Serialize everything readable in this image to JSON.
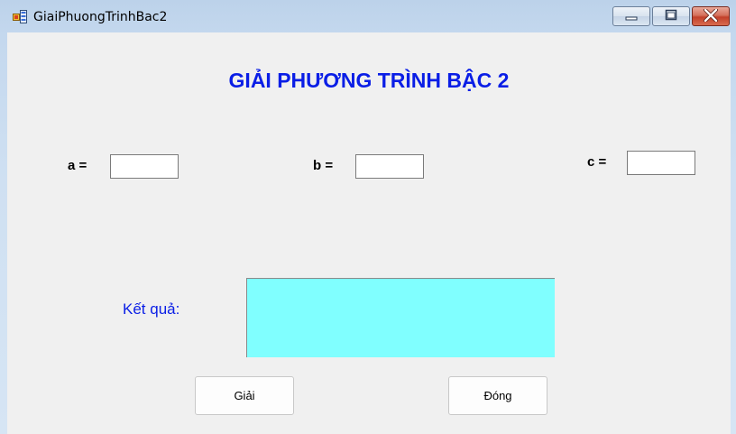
{
  "window": {
    "title": "GiaiPhuongTrinhBac2",
    "controls": {
      "minimize": "minimize-icon",
      "maximize": "maximize-icon",
      "close": "close-icon"
    }
  },
  "form": {
    "heading": "GIẢI PHƯƠNG TRÌNH BẬC 2",
    "labels": {
      "a": "a =",
      "b": "b =",
      "c": "c ="
    },
    "inputs": {
      "a": "",
      "b": "",
      "c": ""
    },
    "result_label": "Kết quả:",
    "result_value": "",
    "buttons": {
      "solve": "Giải",
      "close": "Đóng"
    }
  },
  "colors": {
    "heading": "#0a1ee6",
    "result_label": "#0a1ee6",
    "result_box": "#80ffff",
    "client_bg": "#f0f0f0",
    "close_button": "#c2402a"
  }
}
